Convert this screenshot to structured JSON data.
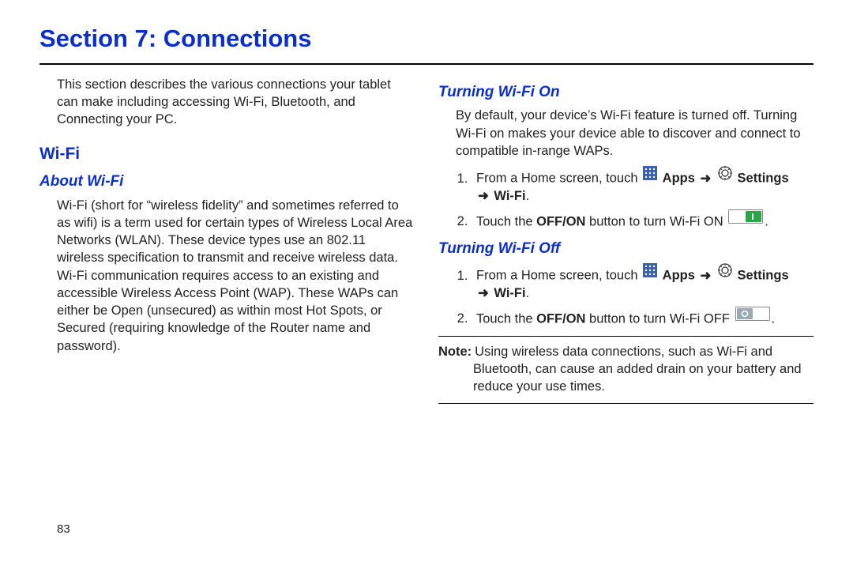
{
  "title": "Section 7: Connections",
  "intro": "This section describes the various connections your tablet can make including accessing Wi-Fi, Bluetooth, and Connecting your PC.",
  "wifi_heading": "Wi-Fi",
  "about_heading": "About Wi-Fi",
  "about_text": "Wi-Fi (short for “wireless fidelity” and sometimes referred to as wifi) is a term used for certain types of Wireless Local Area Networks (WLAN). These device types use an 802.11 wireless specification to transmit and receive wireless data. Wi-Fi communication requires access to an existing and accessible Wireless Access Point (WAP). These WAPs can either be Open (unsecured) as within most Hot Spots, or Secured (requiring knowledge of the Router name and password).",
  "turn_on_heading": "Turning Wi-Fi On",
  "turn_on_intro": "By default, your device’s Wi-Fi feature is turned off. Turning Wi-Fi on makes your device able to discover and connect to compatible in-range WAPs.",
  "turn_on_step1_a": "From a Home screen, touch ",
  "apps_label": "Apps",
  "settings_label": "Settings",
  "wifi_label": "Wi-Fi",
  "turn_on_step2_a": "Touch the ",
  "offon_label": "OFF/ON",
  "turn_on_step2_b": " button to turn Wi-Fi ON ",
  "turn_off_heading": "Turning Wi-Fi Off",
  "turn_off_step2_b": " button to turn Wi-Fi OFF ",
  "note_label": "Note:",
  "note_text": "Using wireless data connections, such as Wi-Fi and Bluetooth, can cause an added drain on your battery and reduce your use times.",
  "page_number": "83",
  "period": ".",
  "arrow": "➜"
}
